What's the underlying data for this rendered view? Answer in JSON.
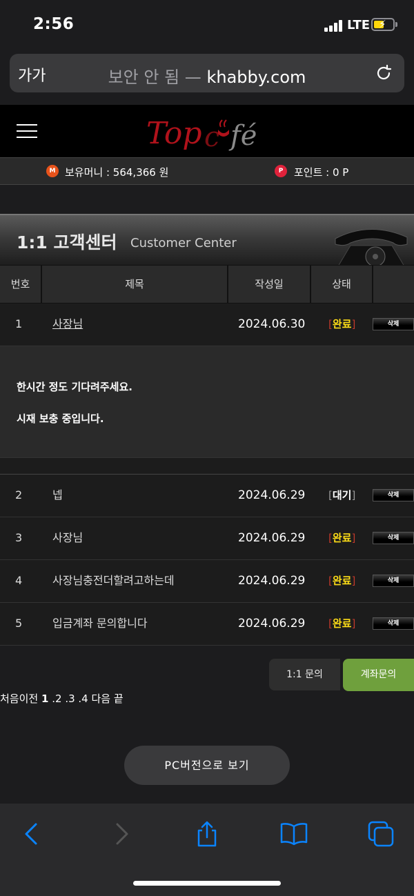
{
  "status_bar": {
    "time": "2:56",
    "network": "LTE"
  },
  "address_bar": {
    "aa": "가가",
    "not_secure": "보안 안 됨 —",
    "domain": "khabby.com"
  },
  "site": {
    "logo": "Top café"
  },
  "money_bar": {
    "money_label": "보유머니 : 564,366 원",
    "points_label": "포인트 : 0 P",
    "money_icon": "M",
    "points_icon": "P"
  },
  "banner": {
    "title": "1:1 고객센터",
    "subtitle": "Customer Center"
  },
  "table": {
    "headers": [
      "번호",
      "제목",
      "작성일",
      "상태",
      ""
    ],
    "rows": [
      {
        "num": "1",
        "subject": "사장님",
        "date": "2024.06.30",
        "status": "완료",
        "delete": "삭제"
      },
      {
        "num": "2",
        "subject": "넵",
        "date": "2024.06.29",
        "status": "대기",
        "delete": "삭제"
      },
      {
        "num": "3",
        "subject": "사장님",
        "date": "2024.06.29",
        "status": "완료",
        "delete": "삭제"
      },
      {
        "num": "4",
        "subject": "사장님충전더할려고하는데",
        "date": "2024.06.29",
        "status": "완료",
        "delete": "삭제"
      },
      {
        "num": "5",
        "subject": "입금계좌 문의합니다",
        "date": "2024.06.29",
        "status": "완료",
        "delete": "삭제"
      }
    ],
    "answer": {
      "line1": "한시간 정도 기다려주세요.",
      "line2": "시재 보충 중입니다."
    },
    "bracket_open": "[",
    "bracket_close": "]"
  },
  "buttons": {
    "inquiry": "1:1 문의",
    "account": "계좌문의",
    "pc_version": "PC버전으로 보기"
  },
  "pagination": {
    "first": "처음",
    "prev": "이전",
    "current": "1",
    "pages": [
      ".2",
      ".3",
      ".4"
    ],
    "next": "다음",
    "last": "끝"
  },
  "colors": {
    "accent_green": "#6fa03d",
    "status_done": "#ffde17",
    "bracket_red": "#c0392b",
    "ios_blue": "#0a84ff"
  },
  "toolbar_icons": [
    "back-icon",
    "forward-icon",
    "share-icon",
    "bookmarks-icon",
    "tabs-icon"
  ]
}
